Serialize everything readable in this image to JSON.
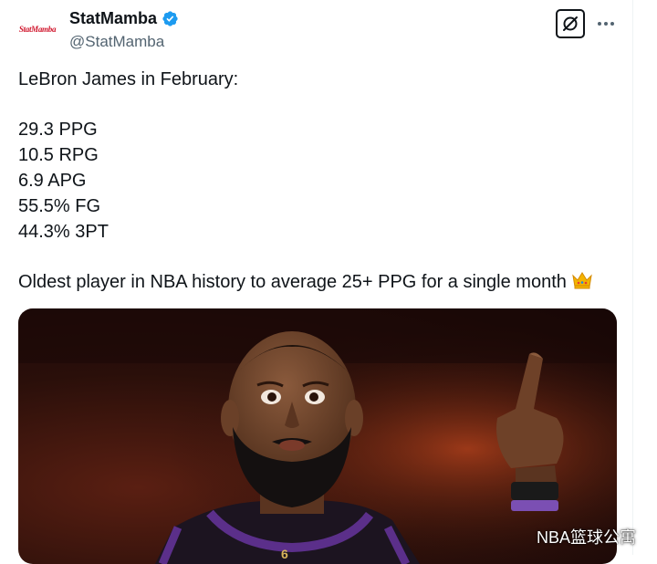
{
  "account": {
    "logo_text": "StatMamba",
    "display_name": "StatMamba",
    "handle": "@StatMamba",
    "verified_color": "#1d9bf0"
  },
  "actions": {
    "grok_icon": "grok-icon",
    "more_icon": "more-icon"
  },
  "tweet": {
    "heading": "LeBron James in February:",
    "stats": [
      "29.3 PPG",
      "10.5 RPG",
      "6.9 APG",
      "55.5% FG",
      "44.3% 3PT"
    ],
    "note": "Oldest player in NBA history to average 25+ PPG for a single month",
    "emoji": "crown-icon"
  },
  "media": {
    "watermark": "NBA篮球公寓",
    "jersey_number": "6"
  },
  "colors": {
    "text": "#0f1419",
    "secondary": "#536471",
    "jersey_purple": "#5b2f8a"
  }
}
